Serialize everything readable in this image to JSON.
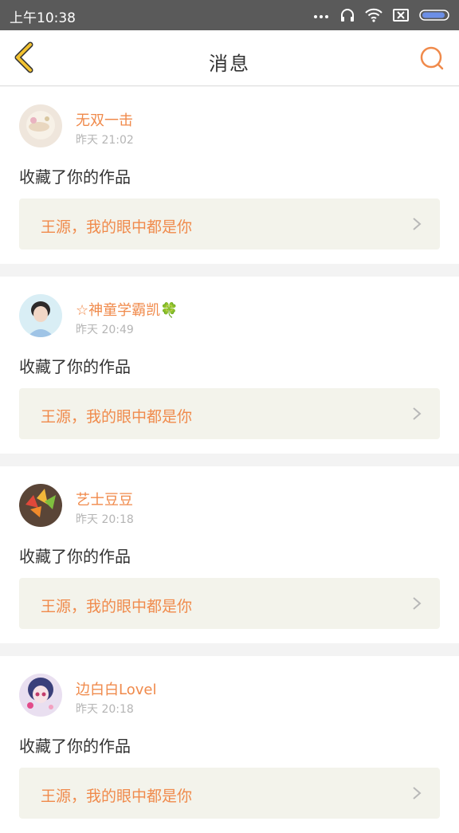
{
  "status_bar": {
    "time": "上午10:38",
    "icons": [
      "more-dots-icon",
      "headphones-icon",
      "wifi-icon",
      "sim-icon",
      "battery-icon"
    ]
  },
  "header": {
    "title": "消息",
    "back_icon": "chevron-left-icon",
    "search_icon": "search-icon"
  },
  "colors": {
    "accent": "#f08a4b",
    "back_icon": "#f2c230",
    "card_link_bg": "#f3f3eb",
    "page_bg": "#f3f3f3"
  },
  "messages": [
    {
      "username": "无双一击",
      "time": "昨天 21:02",
      "action": "收藏了你的作品",
      "work_title": "王源，我的眼中都是你"
    },
    {
      "username": "☆神童学霸凯🍀",
      "time": "昨天 20:49",
      "action": "收藏了你的作品",
      "work_title": "王源，我的眼中都是你"
    },
    {
      "username": "艺士豆豆",
      "time": "昨天 20:18",
      "action": "收藏了你的作品",
      "work_title": "王源，我的眼中都是你"
    },
    {
      "username": "边白白Lovel",
      "time": "昨天 20:18",
      "action": "收藏了你的作品",
      "work_title": "王源，我的眼中都是你"
    }
  ]
}
